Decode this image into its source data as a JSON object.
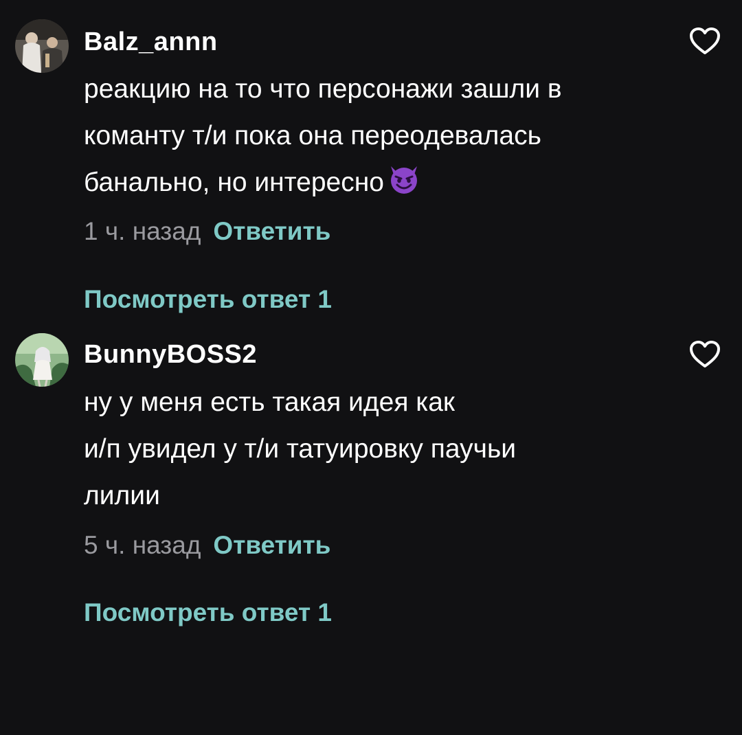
{
  "comments": [
    {
      "username": "Balz_annn",
      "lines": [
        "реакцию на то что персонажи зашли в",
        "команту т/и пока она переодевалась",
        "банально, но интересно"
      ],
      "emoji": "smiling-devil-emoji",
      "time": "1 ч. назад",
      "reply_label": "Ответить",
      "view_replies_label": "Посмотреть ответ 1",
      "avatar": "photo-avatar"
    },
    {
      "username": "BunnyBOSS2",
      "lines": [
        "ну у меня есть такая идея как",
        "и/п увидел у т/и татуировку паучьи",
        "лилии"
      ],
      "time": "5 ч. назад",
      "reply_label": "Ответить",
      "view_replies_label": "Посмотреть ответ 1",
      "avatar": "anime-avatar"
    }
  ],
  "colors": {
    "background": "#111113",
    "text": "#ffffff",
    "muted": "#9a9a9f",
    "accent": "#7fc9c6"
  },
  "icons": {
    "like": "heart-outline-icon"
  }
}
